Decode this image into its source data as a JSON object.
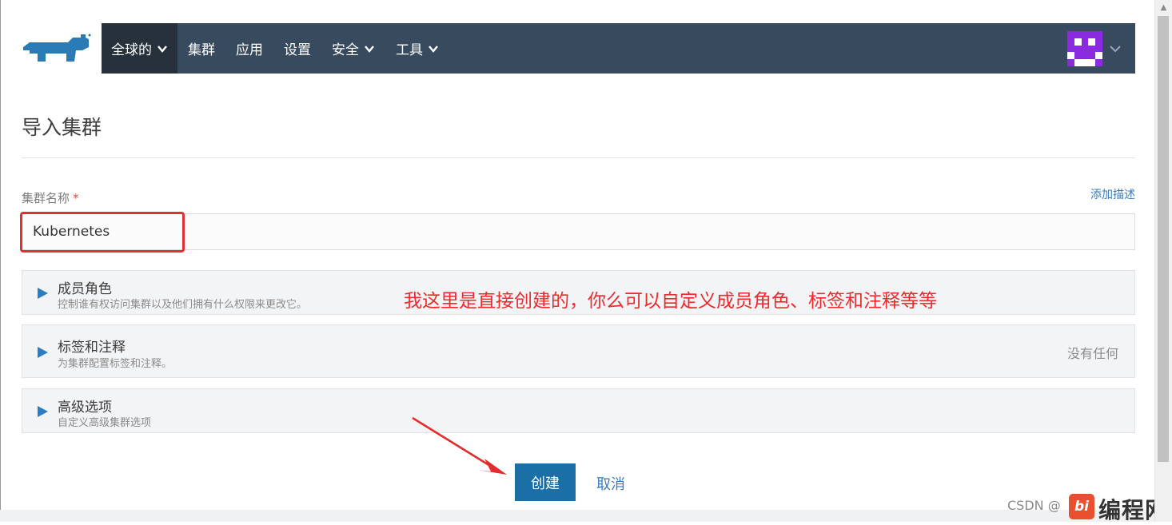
{
  "nav": {
    "items": [
      {
        "label": "全球的",
        "has_dropdown": true,
        "active": true
      },
      {
        "label": "集群",
        "has_dropdown": false
      },
      {
        "label": "应用",
        "has_dropdown": false
      },
      {
        "label": "设置",
        "has_dropdown": false
      },
      {
        "label": "安全",
        "has_dropdown": true
      },
      {
        "label": "工具",
        "has_dropdown": true
      }
    ]
  },
  "colors": {
    "header_bg": "#374a5e",
    "active_nav_bg": "#26313c",
    "accent": "#1a6fa7",
    "link": "#3a7bbf",
    "annotation": "#e03030",
    "avatar": "#8a2be2"
  },
  "icons": {
    "logo": "rancher-logo",
    "avatar": "user-avatar",
    "dropdown": "chevron-down-icon",
    "caret": "caret-right-icon"
  },
  "page": {
    "title": "导入集群"
  },
  "form": {
    "name_label": "集群名称",
    "required_mark": "*",
    "add_description": "添加描述",
    "name_value": "Kubernetes"
  },
  "sections": [
    {
      "title": "成员角色",
      "subtitle": "控制谁有权访问集群以及他们拥有什么权限来更改它。",
      "status": ""
    },
    {
      "title": "标签和注释",
      "subtitle": "为集群配置标签和注释。",
      "status": "没有任何"
    },
    {
      "title": "高级选项",
      "subtitle": "自定义高级集群选项",
      "status": ""
    }
  ],
  "annotation": {
    "text": "我这里是直接创建的，你么可以自定义成员角色、标签和注释等等"
  },
  "actions": {
    "create": "创建",
    "cancel": "取消"
  },
  "watermark": {
    "csdn": "CSDN @",
    "logo_text": "编程网"
  }
}
